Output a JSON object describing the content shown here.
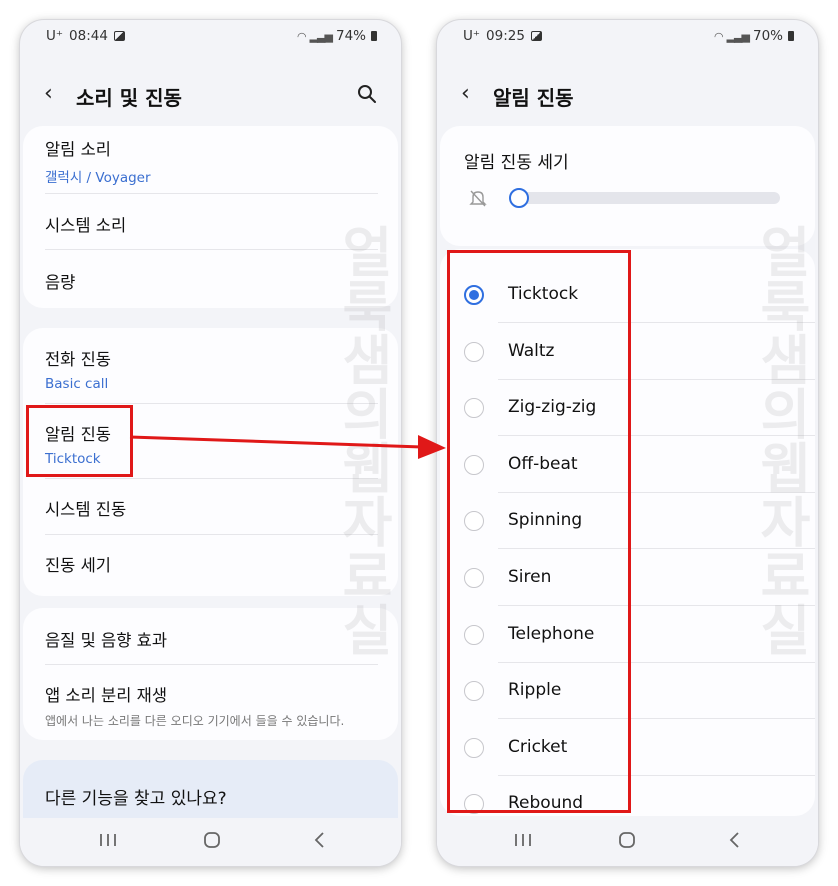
{
  "left_phone": {
    "status": {
      "carrier": "U⁺",
      "time": "08:44",
      "battery": "74%"
    },
    "appbar": {
      "title": "소리 및 진동"
    },
    "group1": [
      {
        "title": "알림 소리",
        "subtitle": "갤럭시 / Voyager"
      },
      {
        "title": "시스템 소리"
      },
      {
        "title": "음량"
      }
    ],
    "group2": [
      {
        "title": "전화 진동",
        "subtitle": "Basic call"
      },
      {
        "title": "알림 진동",
        "subtitle": "Ticktock"
      },
      {
        "title": "시스템 진동"
      },
      {
        "title": "진동 세기"
      }
    ],
    "group3": [
      {
        "title": "음질 및 음향 효과"
      },
      {
        "title": "앱 소리 분리 재생",
        "description": "앱에서 나는 소리를 다른 오디오 기기에서 들을 수 있습니다."
      }
    ],
    "suggestion": {
      "title": "다른 기능을 찾고 있나요?"
    }
  },
  "right_phone": {
    "status": {
      "carrier": "U⁺",
      "time": "09:25",
      "battery": "70%"
    },
    "appbar": {
      "title": "알림 진동"
    },
    "intensity": {
      "label": "알림 진동 세기",
      "level": 0.0
    },
    "patterns": [
      {
        "label": "Ticktock",
        "selected": true
      },
      {
        "label": "Waltz",
        "selected": false
      },
      {
        "label": "Zig-zig-zig",
        "selected": false
      },
      {
        "label": "Off-beat",
        "selected": false
      },
      {
        "label": "Spinning",
        "selected": false
      },
      {
        "label": "Siren",
        "selected": false
      },
      {
        "label": "Telephone",
        "selected": false
      },
      {
        "label": "Ripple",
        "selected": false
      },
      {
        "label": "Cricket",
        "selected": false
      },
      {
        "label": "Rebound",
        "selected": false
      }
    ]
  },
  "watermark": "얼룩샘의웹자료실",
  "colors": {
    "highlight": "#e01818",
    "accent": "#2f6fe0",
    "subtitle": "#3b6fd0"
  },
  "icons": {
    "back": "back-icon",
    "search": "search-icon",
    "gallery": "gallery-icon",
    "mute": "mute-icon",
    "nav": [
      "recent-apps-icon",
      "home-icon",
      "nav-back-icon"
    ]
  }
}
